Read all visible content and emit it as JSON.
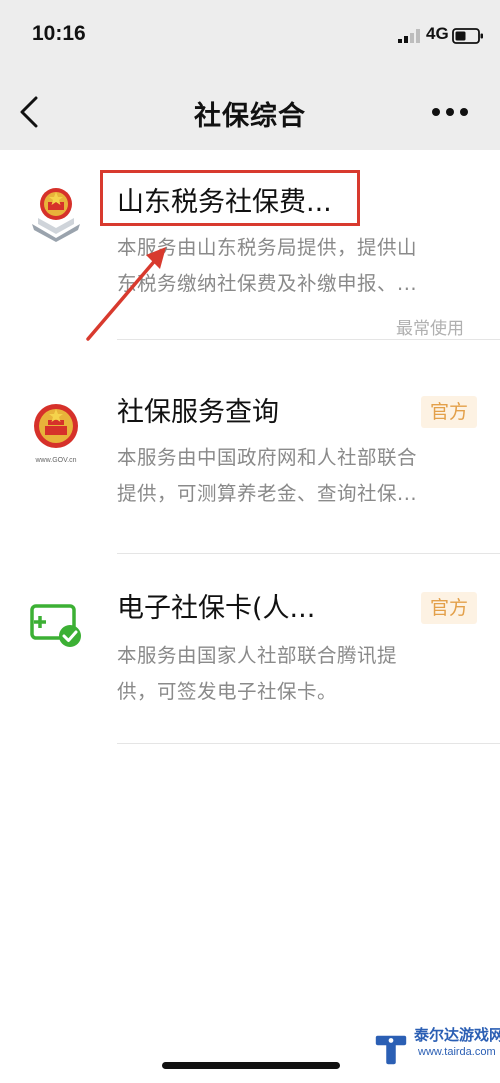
{
  "status_bar": {
    "time": "10:16",
    "network": "4G"
  },
  "nav": {
    "title": "社保综合",
    "back_icon": "chevron-left-icon",
    "more_icon": "more-dots-icon"
  },
  "items": [
    {
      "title": "山东税务社保费...",
      "desc_line1": "本服务由山东税务局提供，提供山",
      "desc_line2": "东税务缴纳社保费及补缴申报、...",
      "usage_tag": "最常使用",
      "icon": "tax-emblem-icon"
    },
    {
      "title": "社保服务查询",
      "badge": "官方",
      "desc_line1": "本服务由中国政府网和人社部联合",
      "desc_line2": "提供，可测算养老金、查询社保...",
      "icon": "gov-emblem-icon",
      "icon_caption": "www.GOV.cn"
    },
    {
      "title": "电子社保卡(人...",
      "badge": "官方",
      "desc_line1": "本服务由国家人社部联合腾讯提",
      "desc_line2": "供，可签发电子社保卡。",
      "icon": "social-card-icon"
    }
  ],
  "watermark": {
    "text": "泰尔达游戏网",
    "url": "www.tairda.com"
  },
  "colors": {
    "annotation_red": "#d83a2e",
    "badge_bg": "#fdf2e3",
    "badge_text": "#e3a04a",
    "card_green": "#3cb034"
  }
}
